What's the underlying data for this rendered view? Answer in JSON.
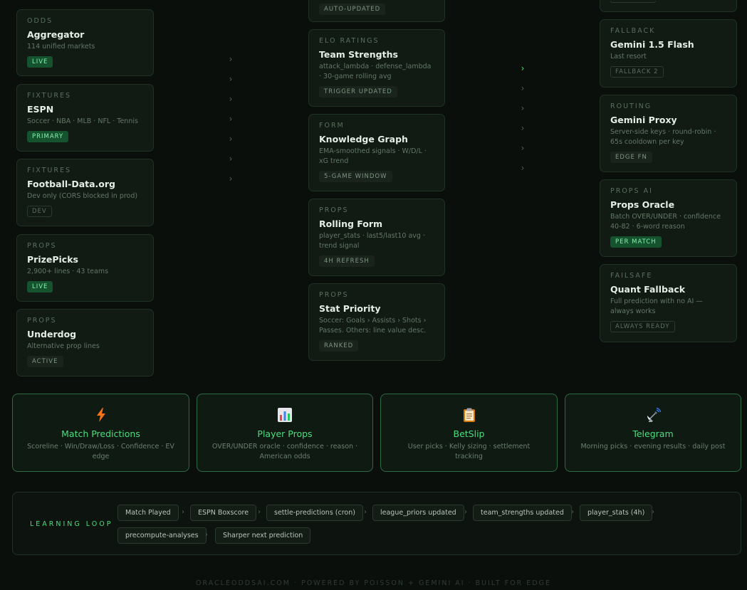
{
  "left_sources": [
    {
      "category": "ODDS",
      "title": "Aggregator",
      "desc": "114 unified markets",
      "badge": "LIVE"
    },
    {
      "category": "FIXTURES",
      "title": "ESPN",
      "desc": "Soccer · NBA · MLB · NFL · Tennis",
      "badge": "PRIMARY"
    },
    {
      "category": "FIXTURES",
      "title": "Football-Data.org",
      "desc": "Dev only (CORS blocked in prod)",
      "badge": "DEV"
    },
    {
      "category": "PROPS",
      "title": "PrizePicks",
      "desc": "2,900+ lines · 43 teams",
      "badge": "LIVE"
    },
    {
      "category": "PROPS",
      "title": "Underdog",
      "desc": "Alternative prop lines",
      "badge": "ACTIVE"
    }
  ],
  "middle_models": {
    "top_badge": "AUTO-UPDATED",
    "cards": [
      {
        "category": "ELO RATINGS",
        "title": "Team Strengths",
        "desc": "attack_lambda · defense_lambda · 30-game rolling avg",
        "badge": "TRIGGER UPDATED"
      },
      {
        "category": "FORM",
        "title": "Knowledge Graph",
        "desc": "EMA-smoothed signals · W/D/L · xG trend",
        "badge": "5-GAME WINDOW"
      },
      {
        "category": "PROPS",
        "title": "Rolling Form",
        "desc": "player_stats · last5/last10 avg · trend signal",
        "badge": "4H REFRESH"
      },
      {
        "category": "PROPS",
        "title": "Stat Priority",
        "desc": "Soccer: Goals › Assists › Shots › Passes. Others: line value desc.",
        "badge": "RANKED"
      }
    ]
  },
  "right_ai": [
    {
      "category": "FALLBACK",
      "title": "Gemini 1.5 Flash",
      "desc": "Last resort",
      "badge": "FALLBACK 2"
    },
    {
      "category": "ROUTING",
      "title": "Gemini Proxy",
      "desc": "Server-side keys · round-robin · 65s cooldown per key",
      "badge": "EDGE FN"
    },
    {
      "category": "PROPS AI",
      "title": "Props Oracle",
      "desc": "Batch OVER/UNDER · confidence 40-82 · 6-word reason",
      "badge": "PER MATCH"
    },
    {
      "category": "FAILSAFE",
      "title": "Quant Fallback",
      "desc": "Full prediction with no AI — always works",
      "badge": "ALWAYS READY"
    }
  ],
  "connectors": {
    "glyph": "›"
  },
  "outputs": [
    {
      "icon": "lightning-icon",
      "title": "Match Predictions",
      "desc": "Scoreline · Win/Draw/Loss · Confidence · EV edge"
    },
    {
      "icon": "bar-chart-icon",
      "title": "Player Props",
      "desc": "OVER/UNDER oracle · confidence · reason · American odds"
    },
    {
      "icon": "clipboard-icon",
      "title": "BetSlip",
      "desc": "User picks · Kelly sizing · settlement tracking"
    },
    {
      "icon": "satellite-icon",
      "title": "Telegram",
      "desc": "Morning picks · evening results · daily post"
    }
  ],
  "learning_loop": {
    "label": "LEARNING LOOP",
    "steps": [
      "Match Played",
      "ESPN Boxscore",
      "settle-predictions (cron)",
      "league_priors updated",
      "team_strengths updated",
      "player_stats (4h)",
      "precompute-analyses",
      "Sharper next prediction"
    ]
  },
  "footer": "ORACLEODDSAI.COM · POWERED BY POISSON + GEMINI AI · BUILT FOR EDGE",
  "colors": {
    "accent": "#4ade80",
    "badge_green_bg": "#14532d",
    "background": "#0b0f0c"
  }
}
